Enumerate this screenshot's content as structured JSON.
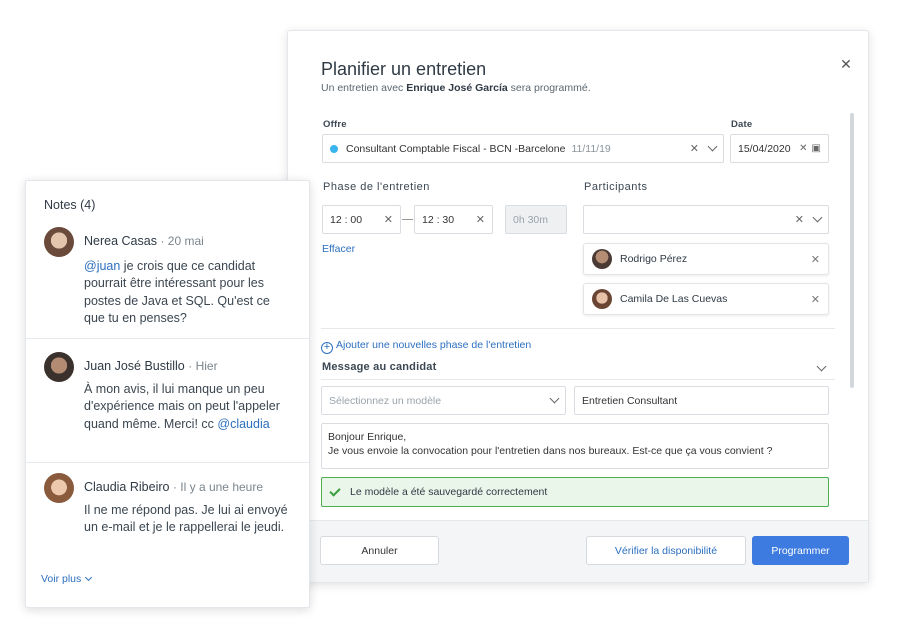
{
  "modal": {
    "title": "Planifier un entretien",
    "subtitle_prefix": "Un entretien avec ",
    "candidate_name": "Enrique José García",
    "subtitle_suffix": " sera programmé.",
    "close_icon": "close-icon"
  },
  "form": {
    "offer_label": "Offre",
    "offer_value": "Consultant Comptable Fiscal - BCN -Barcelone",
    "offer_date": "11/11/19",
    "date_label": "Date",
    "date_value": "15/04/2020",
    "phase_label": "Phase de l'entretien",
    "start_time": "12 : 00",
    "end_time": "12 : 30",
    "duration_placeholder": "0h 30m",
    "clear_link": "Effacer",
    "participants_label": "Participants",
    "participants": [
      {
        "name": "Rodrigo Pérez"
      },
      {
        "name": "Camila De Las Cuevas"
      }
    ],
    "add_phase_link": "Ajouter une nouvelles phase de l'entretien",
    "message_label": "Message au candidat",
    "template_placeholder": "Sélectionnez un modèle",
    "template_name": "Entretien Consultant",
    "message_line1": "Bonjour Enrique,",
    "message_line2": "Je vous envoie la convocation pour l'entretien dans nos bureaux. Est-ce que ça vous convient ?",
    "success_message": "Le modèle a été sauvegardé correctement"
  },
  "footer": {
    "cancel": "Annuler",
    "check_availability": "Vérifier la disponibilité",
    "schedule": "Programmer"
  },
  "notes": {
    "title": "Notes (4)",
    "items": [
      {
        "author": "Nerea Casas",
        "time": "· 20 mai",
        "mention": "@juan",
        "text": " je crois que ce candidat pourrait être intéressant pour les postes de Java et SQL. Qu'est ce que tu en penses?"
      },
      {
        "author": "Juan José Bustillo",
        "time": "· Hier",
        "text": "À mon avis, il lui manque un peu d'expérience mais on peut l'appeler quand même. Merci! cc ",
        "mention": "@claudia"
      },
      {
        "author": "Claudia Ribeiro",
        "time": "· Il y a une heure",
        "text": "Il ne me répond pas. Je lui ai envoyé un e-mail et je le rappellerai le jeudi."
      }
    ],
    "more_link": "Voir plus"
  },
  "colors": {
    "primary": "#3d7be0",
    "link": "#2c6fbf",
    "success_border": "#4caf50",
    "offer_dot": "#3ab4ee"
  }
}
